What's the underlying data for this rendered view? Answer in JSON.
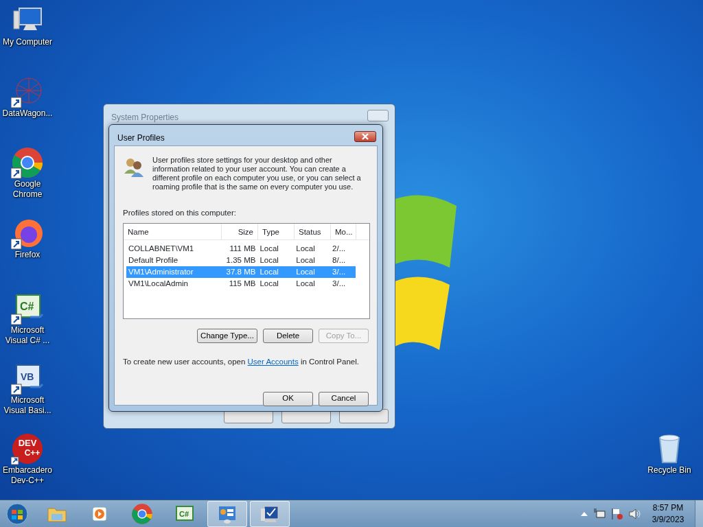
{
  "desktop_icons": [
    {
      "kind": "computer",
      "label": "My Computer"
    },
    {
      "kind": "network-graph",
      "label": "DataWagon..."
    },
    {
      "kind": "chrome",
      "label": "Google Chrome"
    },
    {
      "kind": "firefox",
      "label": "Firefox"
    },
    {
      "kind": "csharp",
      "icon_text": "C#",
      "label": "Microsoft Visual C# ..."
    },
    {
      "kind": "vb",
      "icon_text": "VB",
      "label": "Microsoft Visual Basi..."
    },
    {
      "kind": "devcpp",
      "icon_text": "DEV C++",
      "label": "Embarcadero Dev-C++"
    },
    {
      "kind": "recycle",
      "label": "Recycle Bin"
    }
  ],
  "system_properties": {
    "title": "System Properties"
  },
  "user_profiles": {
    "title": "User Profiles",
    "description": "User profiles store settings for your desktop and other information related to your user account. You can create a different profile on each computer you use, or you can select a roaming profile that is the same on every computer you use.",
    "list_label": "Profiles stored on this computer:",
    "columns": [
      "Name",
      "Size",
      "Type",
      "Status",
      "Mo..."
    ],
    "rows": [
      {
        "cells": [
          "COLLABNET\\VM1",
          "111 MB",
          "Local",
          "Local",
          "2/..."
        ],
        "selected": false
      },
      {
        "cells": [
          "Default Profile",
          "1.35 MB",
          "Local",
          "Local",
          "8/..."
        ],
        "selected": false
      },
      {
        "cells": [
          "VM1\\Administrator",
          "37.8 MB",
          "Local",
          "Local",
          "3/..."
        ],
        "selected": true
      },
      {
        "cells": [
          "VM1\\LocalAdmin",
          "115 MB",
          "Local",
          "Local",
          "3/..."
        ],
        "selected": false
      }
    ],
    "buttons": [
      {
        "label": "Change Type...",
        "disabled": false
      },
      {
        "label": "Delete",
        "disabled": false
      },
      {
        "label": "Copy To...",
        "disabled": true
      }
    ],
    "footer": {
      "before": "To create new user accounts, open",
      "link": "User Accounts",
      "after": "in Control Panel."
    },
    "dialog_buttons": [
      "OK",
      "Cancel"
    ]
  },
  "taskbar": {
    "apps": [
      {
        "kind": "start",
        "running": false
      },
      {
        "kind": "folder",
        "running": false
      },
      {
        "kind": "media",
        "running": false
      },
      {
        "kind": "chrome",
        "running": false
      },
      {
        "kind": "csharp",
        "icon_text": "C#",
        "running": false
      },
      {
        "kind": "control-panel",
        "running": true
      },
      {
        "kind": "system",
        "running": true
      }
    ],
    "time": "8:57 PM",
    "date": "3/9/2023"
  }
}
